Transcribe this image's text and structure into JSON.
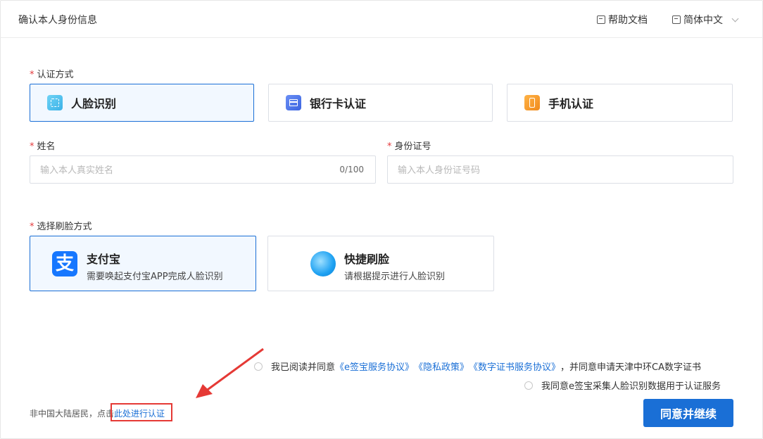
{
  "header": {
    "title": "确认本人身份信息",
    "help_label": "帮助文档",
    "lang_label": "简体中文"
  },
  "auth_method": {
    "label": "认证方式",
    "required_mark": "*",
    "options": [
      {
        "label": "人脸识别",
        "icon": "face-scan-icon",
        "selected": true
      },
      {
        "label": "银行卡认证",
        "icon": "bank-card-icon",
        "selected": false
      },
      {
        "label": "手机认证",
        "icon": "phone-icon",
        "selected": false
      }
    ]
  },
  "name_field": {
    "label": "姓名",
    "placeholder": "输入本人真实姓名",
    "value": "",
    "counter": "0/100"
  },
  "id_field": {
    "label": "身份证号",
    "placeholder": "输入本人身份证号码",
    "value": ""
  },
  "scan_method": {
    "label": "选择刷脸方式",
    "options": [
      {
        "title": "支付宝",
        "desc": "需要唤起支付宝APP完成人脸识别",
        "icon": "alipay-icon",
        "icon_glyph": "支",
        "selected": true
      },
      {
        "title": "快捷刷脸",
        "desc": "请根据提示进行人脸识别",
        "icon": "quick-face-icon",
        "selected": false
      }
    ]
  },
  "agreements": {
    "line1_prefix": "我已阅读并同意",
    "link1": "《e签宝服务协议》",
    "link2": "《隐私政策》",
    "link3": "《数字证书服务协议》",
    "line1_suffix": "，并同意申请天津中环CA数字证书",
    "line2": "我同意e签宝采集人脸识别数据用于认证服务"
  },
  "footer": {
    "prefix": "非中国大陆居民，点击",
    "link": "此处进行认证"
  },
  "submit_label": "同意并继续",
  "colors": {
    "primary": "#1a6fd6",
    "required": "#e4393c",
    "annotation": "#e53935"
  }
}
